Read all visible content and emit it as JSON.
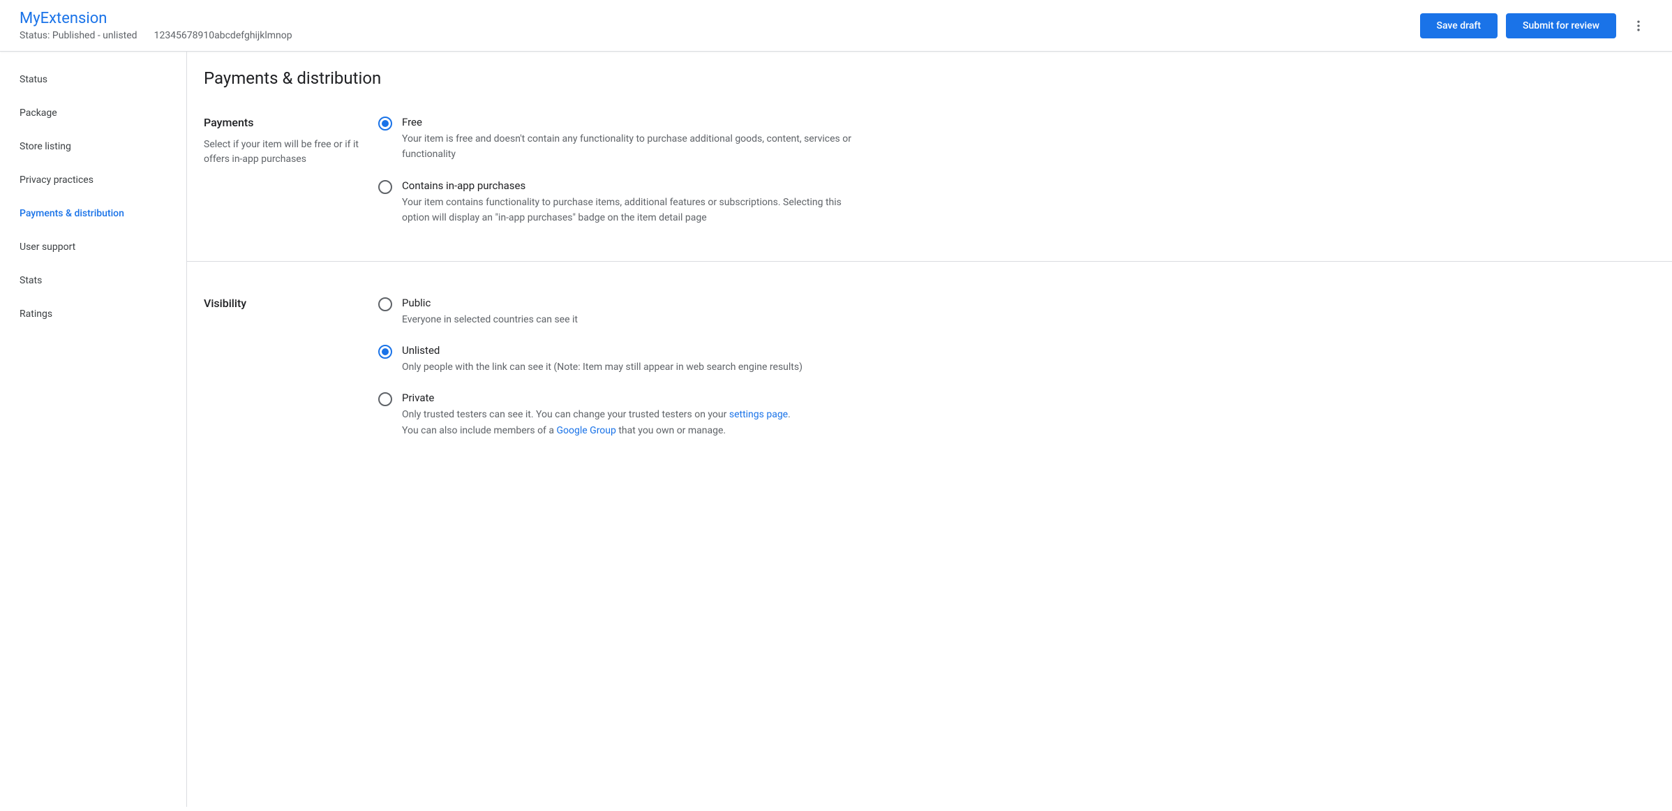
{
  "header": {
    "title": "MyExtension",
    "status": "Status: Published - unlisted",
    "id": "12345678910abcdefghijklmnop",
    "save_draft": "Save draft",
    "submit_review": "Submit for review"
  },
  "sidebar": {
    "items": [
      {
        "label": "Status"
      },
      {
        "label": "Package"
      },
      {
        "label": "Store listing"
      },
      {
        "label": "Privacy practices"
      },
      {
        "label": "Payments & distribution"
      },
      {
        "label": "User support"
      },
      {
        "label": "Stats"
      },
      {
        "label": "Ratings"
      }
    ]
  },
  "page": {
    "title": "Payments & distribution"
  },
  "payments": {
    "title": "Payments",
    "desc": "Select if your item will be free or if it offers in-app purchases",
    "options": [
      {
        "label": "Free",
        "desc": "Your item is free and doesn't contain any functionality to purchase additional goods, content, services or functionality"
      },
      {
        "label": "Contains in-app purchases",
        "desc": "Your item contains functionality to purchase items, additional features or subscriptions. Selecting this option will display an \"in-app purchases\" badge on the item detail page"
      }
    ]
  },
  "visibility": {
    "title": "Visibility",
    "options": [
      {
        "label": "Public",
        "desc": "Everyone in selected countries can see it"
      },
      {
        "label": "Unlisted",
        "desc": "Only people with the link can see it (Note: Item may still appear in web search engine results)"
      },
      {
        "label": "Private",
        "desc_part1": "Only trusted testers can see it. You can change your trusted testers on your ",
        "link1": "settings page",
        "desc_part2": ".",
        "desc_part3": "You can also include members of a ",
        "link2": "Google Group",
        "desc_part4": " that you own or manage."
      }
    ]
  }
}
